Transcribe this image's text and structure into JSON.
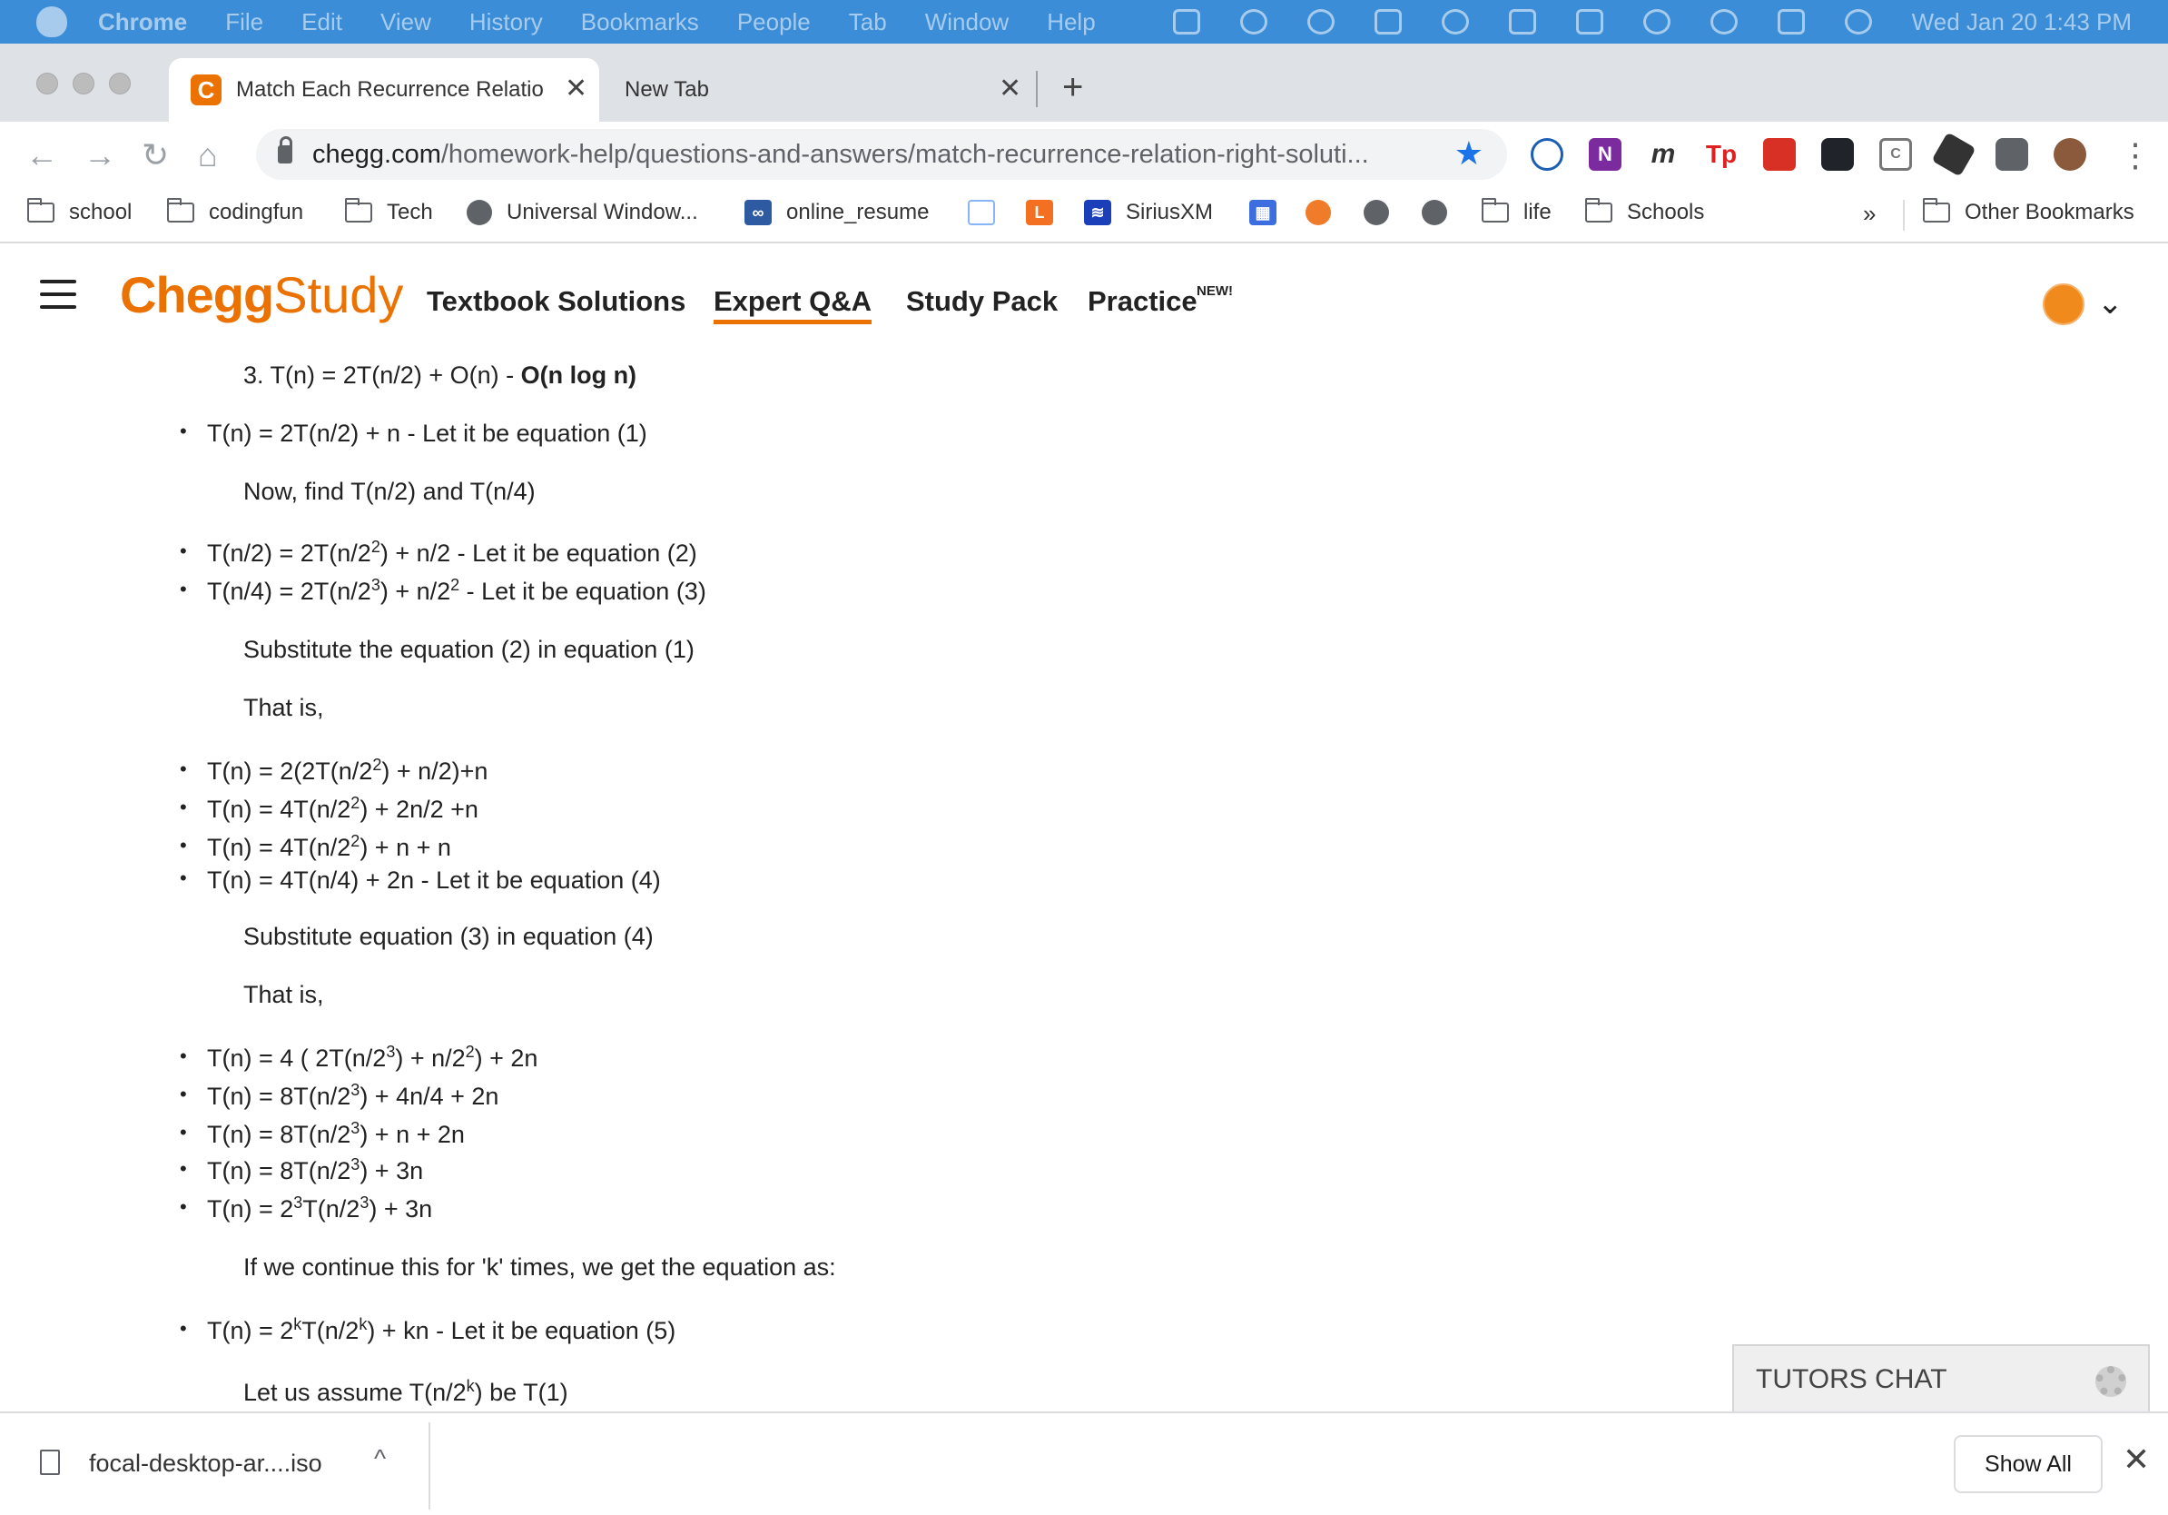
{
  "menubar": {
    "app": "Chrome",
    "items": [
      "File",
      "Edit",
      "View",
      "History",
      "Bookmarks",
      "People",
      "Tab",
      "Window",
      "Help"
    ],
    "clock": "Wed Jan 20  1:43 PM"
  },
  "tabs": [
    {
      "title": "Match Each Recurrence Relatio",
      "active": true
    },
    {
      "title": "New Tab",
      "active": false
    }
  ],
  "toolbar": {
    "url_host": "chegg.com",
    "url_path": "/homework-help/questions-and-answers/match-recurrence-relation-right-soluti..."
  },
  "bookmarks": {
    "items": [
      "school",
      "codingfun",
      "Tech",
      "Universal Window...",
      "online_resume",
      "SiriusXM",
      "life",
      "Schools"
    ],
    "overflow": "»",
    "other": "Other Bookmarks"
  },
  "chegg": {
    "logo_chegg": "Chegg",
    "logo_study": "Study",
    "nav": [
      "Textbook Solutions",
      "Expert Q&A",
      "Study Pack",
      "Practice"
    ],
    "new_badge": "NEW!"
  },
  "article": {
    "l1_prefix": "3. T(n) = 2T(n/2) + O(n) - ",
    "l1_bold": "O(n log n)",
    "l2": "T(n) = 2T(n/2) + n - Let it be equation (1)",
    "l3": "Now, find T(n/2) and T(n/4)",
    "l6": "Substitute the equation (2) in equation (1)",
    "l7": "That is,",
    "l11": "T(n) = 4T(n/4) + 2n - Let it be equation (4)",
    "l12": "Substitute equation (3) in equation (4)",
    "l13": "That is,",
    "l19": "If we continue this for 'k' times, we get the equation as:"
  },
  "tutors_chat": "TUTORS CHAT",
  "downloads": {
    "file": "focal-desktop-ar....iso",
    "show_all": "Show All"
  }
}
